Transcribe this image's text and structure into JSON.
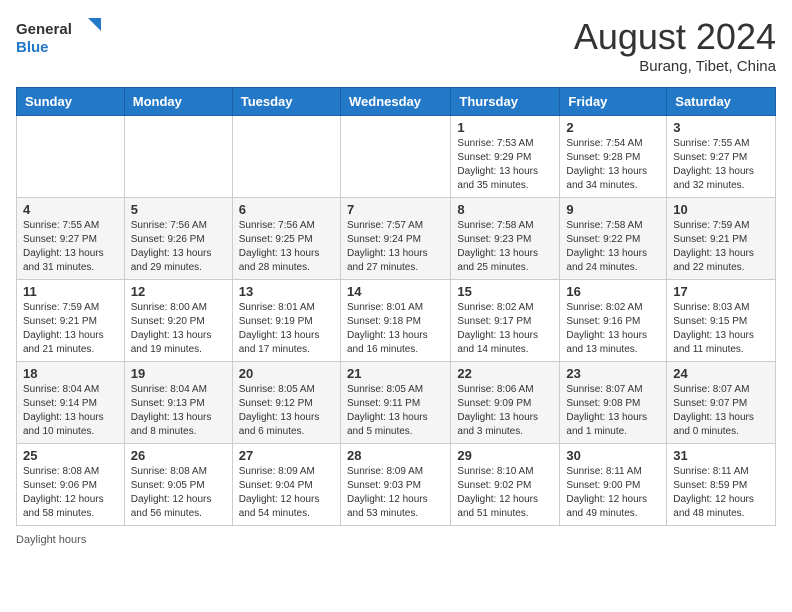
{
  "logo": {
    "line1": "General",
    "line2": "Blue"
  },
  "header": {
    "month_year": "August 2024",
    "location": "Burang, Tibet, China"
  },
  "weekdays": [
    "Sunday",
    "Monday",
    "Tuesday",
    "Wednesday",
    "Thursday",
    "Friday",
    "Saturday"
  ],
  "weeks": [
    [
      {
        "day": "",
        "info": ""
      },
      {
        "day": "",
        "info": ""
      },
      {
        "day": "",
        "info": ""
      },
      {
        "day": "",
        "info": ""
      },
      {
        "day": "1",
        "info": "Sunrise: 7:53 AM\nSunset: 9:29 PM\nDaylight: 13 hours and 35 minutes."
      },
      {
        "day": "2",
        "info": "Sunrise: 7:54 AM\nSunset: 9:28 PM\nDaylight: 13 hours and 34 minutes."
      },
      {
        "day": "3",
        "info": "Sunrise: 7:55 AM\nSunset: 9:27 PM\nDaylight: 13 hours and 32 minutes."
      }
    ],
    [
      {
        "day": "4",
        "info": "Sunrise: 7:55 AM\nSunset: 9:27 PM\nDaylight: 13 hours and 31 minutes."
      },
      {
        "day": "5",
        "info": "Sunrise: 7:56 AM\nSunset: 9:26 PM\nDaylight: 13 hours and 29 minutes."
      },
      {
        "day": "6",
        "info": "Sunrise: 7:56 AM\nSunset: 9:25 PM\nDaylight: 13 hours and 28 minutes."
      },
      {
        "day": "7",
        "info": "Sunrise: 7:57 AM\nSunset: 9:24 PM\nDaylight: 13 hours and 27 minutes."
      },
      {
        "day": "8",
        "info": "Sunrise: 7:58 AM\nSunset: 9:23 PM\nDaylight: 13 hours and 25 minutes."
      },
      {
        "day": "9",
        "info": "Sunrise: 7:58 AM\nSunset: 9:22 PM\nDaylight: 13 hours and 24 minutes."
      },
      {
        "day": "10",
        "info": "Sunrise: 7:59 AM\nSunset: 9:21 PM\nDaylight: 13 hours and 22 minutes."
      }
    ],
    [
      {
        "day": "11",
        "info": "Sunrise: 7:59 AM\nSunset: 9:21 PM\nDaylight: 13 hours and 21 minutes."
      },
      {
        "day": "12",
        "info": "Sunrise: 8:00 AM\nSunset: 9:20 PM\nDaylight: 13 hours and 19 minutes."
      },
      {
        "day": "13",
        "info": "Sunrise: 8:01 AM\nSunset: 9:19 PM\nDaylight: 13 hours and 17 minutes."
      },
      {
        "day": "14",
        "info": "Sunrise: 8:01 AM\nSunset: 9:18 PM\nDaylight: 13 hours and 16 minutes."
      },
      {
        "day": "15",
        "info": "Sunrise: 8:02 AM\nSunset: 9:17 PM\nDaylight: 13 hours and 14 minutes."
      },
      {
        "day": "16",
        "info": "Sunrise: 8:02 AM\nSunset: 9:16 PM\nDaylight: 13 hours and 13 minutes."
      },
      {
        "day": "17",
        "info": "Sunrise: 8:03 AM\nSunset: 9:15 PM\nDaylight: 13 hours and 11 minutes."
      }
    ],
    [
      {
        "day": "18",
        "info": "Sunrise: 8:04 AM\nSunset: 9:14 PM\nDaylight: 13 hours and 10 minutes."
      },
      {
        "day": "19",
        "info": "Sunrise: 8:04 AM\nSunset: 9:13 PM\nDaylight: 13 hours and 8 minutes."
      },
      {
        "day": "20",
        "info": "Sunrise: 8:05 AM\nSunset: 9:12 PM\nDaylight: 13 hours and 6 minutes."
      },
      {
        "day": "21",
        "info": "Sunrise: 8:05 AM\nSunset: 9:11 PM\nDaylight: 13 hours and 5 minutes."
      },
      {
        "day": "22",
        "info": "Sunrise: 8:06 AM\nSunset: 9:09 PM\nDaylight: 13 hours and 3 minutes."
      },
      {
        "day": "23",
        "info": "Sunrise: 8:07 AM\nSunset: 9:08 PM\nDaylight: 13 hours and 1 minute."
      },
      {
        "day": "24",
        "info": "Sunrise: 8:07 AM\nSunset: 9:07 PM\nDaylight: 13 hours and 0 minutes."
      }
    ],
    [
      {
        "day": "25",
        "info": "Sunrise: 8:08 AM\nSunset: 9:06 PM\nDaylight: 12 hours and 58 minutes."
      },
      {
        "day": "26",
        "info": "Sunrise: 8:08 AM\nSunset: 9:05 PM\nDaylight: 12 hours and 56 minutes."
      },
      {
        "day": "27",
        "info": "Sunrise: 8:09 AM\nSunset: 9:04 PM\nDaylight: 12 hours and 54 minutes."
      },
      {
        "day": "28",
        "info": "Sunrise: 8:09 AM\nSunset: 9:03 PM\nDaylight: 12 hours and 53 minutes."
      },
      {
        "day": "29",
        "info": "Sunrise: 8:10 AM\nSunset: 9:02 PM\nDaylight: 12 hours and 51 minutes."
      },
      {
        "day": "30",
        "info": "Sunrise: 8:11 AM\nSunset: 9:00 PM\nDaylight: 12 hours and 49 minutes."
      },
      {
        "day": "31",
        "info": "Sunrise: 8:11 AM\nSunset: 8:59 PM\nDaylight: 12 hours and 48 minutes."
      }
    ]
  ],
  "footer": {
    "label": "Daylight hours"
  }
}
